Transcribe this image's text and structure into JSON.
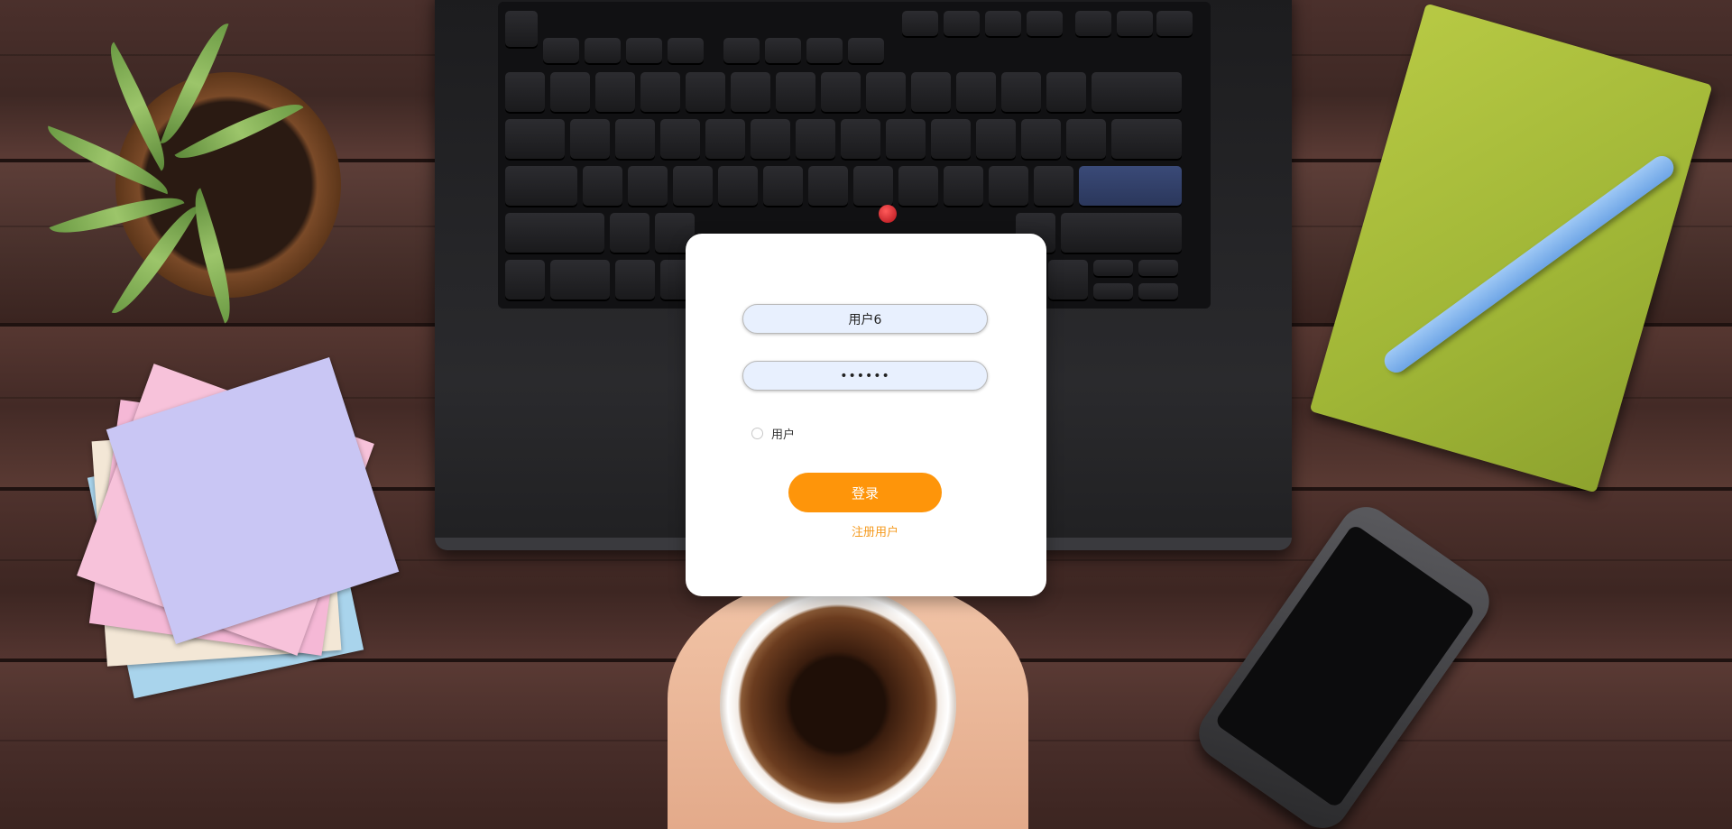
{
  "login": {
    "username_value": "用户6",
    "password_value": "••••••",
    "role_label": "用户",
    "login_button_label": "登录",
    "register_link_label": "注册用户"
  },
  "colors": {
    "accent": "#fe950a",
    "link": "#f59a1e",
    "card_background": "#ffffff",
    "input_background": "#e8f0fe"
  }
}
